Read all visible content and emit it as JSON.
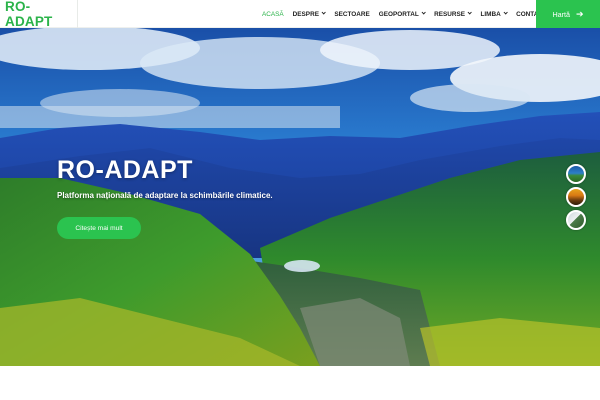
{
  "header": {
    "logo": "RO-ADAPT",
    "nav": [
      {
        "label": "ACASĂ",
        "active": true,
        "has_dropdown": false
      },
      {
        "label": "DESPRE",
        "active": false,
        "has_dropdown": true
      },
      {
        "label": "SECTOARE",
        "active": false,
        "has_dropdown": false
      },
      {
        "label": "GEOPORTAL",
        "active": false,
        "has_dropdown": true
      },
      {
        "label": "RESURSE",
        "active": false,
        "has_dropdown": true
      },
      {
        "label": "LIMBA",
        "active": false,
        "has_dropdown": true
      },
      {
        "label": "CONTACT",
        "active": false,
        "has_dropdown": false
      }
    ],
    "map_button": "Hartă",
    "map_button_icon": "arrow-right-icon"
  },
  "hero": {
    "title": "RO-ADAPT",
    "subtitle": "Platforma națională de adaptare la schimbările climatice.",
    "cta": "Citește mai mult",
    "slides": 3,
    "active_slide": 1
  },
  "colors": {
    "brand_green": "#2bb34a",
    "button_green": "#2bc34f",
    "text_dark": "#222222"
  }
}
